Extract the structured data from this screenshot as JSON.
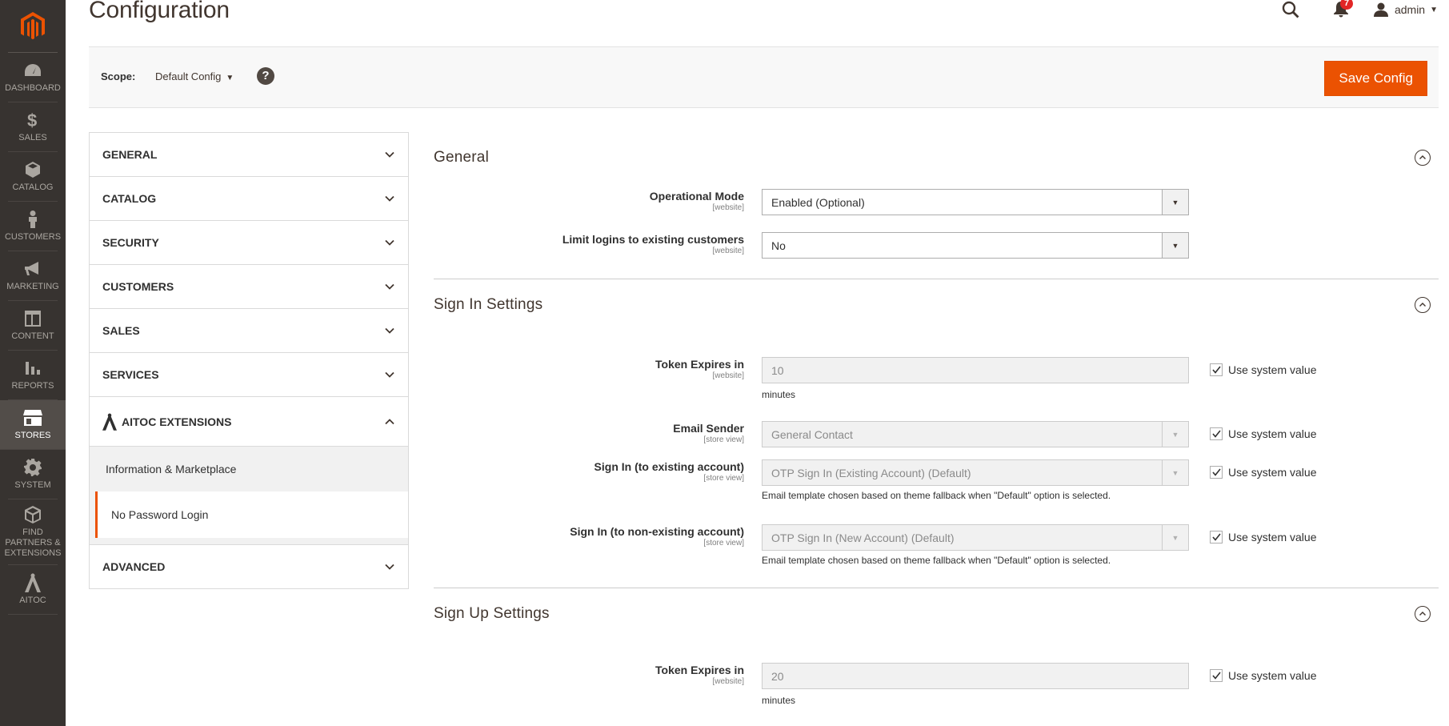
{
  "page": {
    "title": "Configuration"
  },
  "header": {
    "notification_count": "7",
    "admin_user": "admin"
  },
  "admin_menu": [
    {
      "label": "DASHBOARD",
      "icon": "dashboard-icon"
    },
    {
      "label": "SALES",
      "icon": "dollar-icon"
    },
    {
      "label": "CATALOG",
      "icon": "box-icon"
    },
    {
      "label": "CUSTOMERS",
      "icon": "person-icon"
    },
    {
      "label": "MARKETING",
      "icon": "megaphone-icon"
    },
    {
      "label": "CONTENT",
      "icon": "layout-icon"
    },
    {
      "label": "REPORTS",
      "icon": "bar-chart-icon"
    },
    {
      "label": "STORES",
      "icon": "store-icon"
    },
    {
      "label": "SYSTEM",
      "icon": "gear-icon"
    },
    {
      "label": "FIND PARTNERS & EXTENSIONS",
      "icon": "blocks-icon"
    },
    {
      "label": "AITOC",
      "icon": "aitoc-icon"
    }
  ],
  "toolbar": {
    "scope_label": "Scope:",
    "scope_value": "Default Config",
    "help": "?",
    "save_label": "Save Config"
  },
  "config_nav": {
    "general": "GENERAL",
    "catalog": "CATALOG",
    "security": "SECURITY",
    "customers": "CUSTOMERS",
    "sales": "SALES",
    "services": "SERVICES",
    "aitoc": "AITOC EXTENSIONS",
    "aitoc_items": [
      "Information & Marketplace",
      "No Password Login"
    ],
    "advanced": "ADVANCED"
  },
  "sections": {
    "general": {
      "title": "General",
      "fields": [
        {
          "label": "Operational Mode",
          "scope": "[website]",
          "value": "Enabled (Optional)"
        },
        {
          "label": "Limit logins to existing customers",
          "scope": "[website]",
          "value": "No"
        }
      ]
    },
    "sign_in": {
      "title": "Sign In Settings",
      "fields": [
        {
          "label": "Token Expires in",
          "scope": "[website]",
          "value": "10",
          "note": "minutes",
          "use_system": "Use system value"
        },
        {
          "label": "Email Sender",
          "scope": "[store view]",
          "value": "General Contact",
          "use_system": "Use system value"
        },
        {
          "label": "Sign In (to existing account)",
          "scope": "[store view]",
          "value": "OTP Sign In (Existing Account) (Default)",
          "note": "Email template chosen based on theme fallback when \"Default\" option is selected.",
          "use_system": "Use system value"
        },
        {
          "label": "Sign In (to non-existing account)",
          "scope": "[store view]",
          "value": "OTP Sign In (New Account) (Default)",
          "note": "Email template chosen based on theme fallback when \"Default\" option is selected.",
          "use_system": "Use system value"
        }
      ]
    },
    "sign_up": {
      "title": "Sign Up Settings",
      "fields": [
        {
          "label": "Token Expires in",
          "scope": "[website]",
          "value": "20",
          "note": "minutes",
          "use_system": "Use system value"
        }
      ]
    }
  },
  "colors": {
    "accent": "#eb5202",
    "menu_bg": "#373330",
    "menu_active": "#524d49"
  }
}
